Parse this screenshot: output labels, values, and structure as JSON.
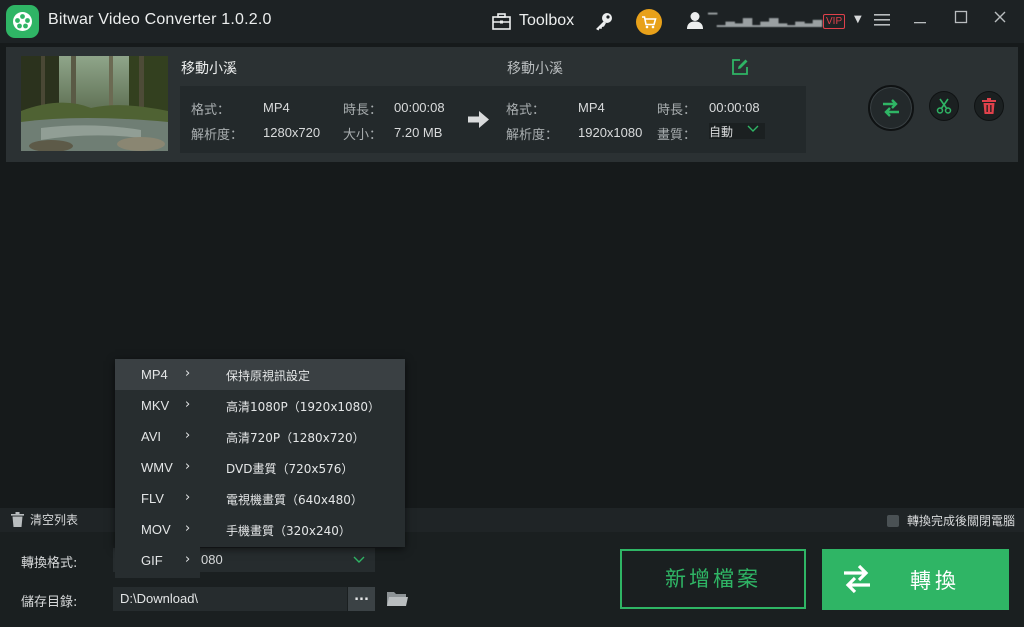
{
  "window": {
    "title": "Bitwar Video Converter  1.0.2.0",
    "toolbox_label": "Toolbox",
    "username": "▔▁▃▂▅▁▃▅▂▁▃▂▄",
    "vip_label": "VIP",
    "menu_icon": "hamburger-icon",
    "minimize": "—",
    "maximize": "☐",
    "close": "✕"
  },
  "file": {
    "source_name": "移動小溪",
    "output_name": "移動小溪",
    "source": {
      "format_label": "格式：",
      "format": "MP4",
      "duration_label": "時長：",
      "duration": "00:00:08",
      "resolution_label": "解析度：",
      "resolution": "1280x720",
      "size_label": "大小：",
      "size": "7.20 MB"
    },
    "output": {
      "format_label": "格式：",
      "format": "MP4",
      "duration_label": "時長：",
      "duration": "00:00:08",
      "resolution_label": "解析度：",
      "resolution": "1920x1080",
      "quality_label": "畫質：",
      "quality": "自動"
    }
  },
  "list_toolbar": {
    "clear_label": "清空列表",
    "shutdown_label": "轉換完成後關閉電腦"
  },
  "bottom": {
    "format_label": "轉換格式:",
    "format_value": "080",
    "save_label": "儲存目錄:",
    "save_path": "D:\\Download\\",
    "browse_label": "...",
    "add_file_label": "新增檔案",
    "convert_label": "轉換"
  },
  "format_menu": {
    "formats": [
      "MP4",
      "MKV",
      "AVI",
      "WMV",
      "FLV",
      "MOV",
      "GIF"
    ],
    "caret": "›",
    "presets": [
      "保持原視訊設定",
      "高清1080P（1920x1080）",
      "高清720P（1280x720）",
      "DVD畫質（720x576）",
      "電視機畫質（640x480）",
      "手機畫質（320x240）"
    ]
  },
  "colors": {
    "accent": "#2fb565",
    "vip": "#e0414b",
    "cart": "#e8a11a",
    "background": "#161a1b"
  }
}
